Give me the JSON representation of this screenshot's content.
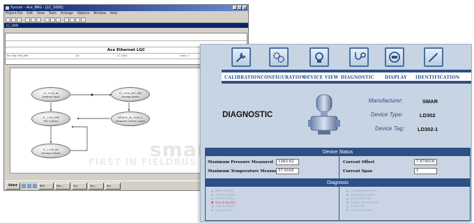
{
  "background_app": {
    "title": "Syscon - Ace_BRG - [LC_1000]",
    "window_buttons": [
      "_",
      "□",
      "×"
    ],
    "menu": [
      "Project File",
      "Edit",
      "View",
      "Tools",
      "Arrange",
      "Options",
      "Window",
      "Help"
    ],
    "inner_title": "LC_1000",
    "header_title": "Ace Ethernet LGC",
    "header_cells": [
      "Bus Tag: HSE_Net",
      "1/0",
      "LC-1000",
      "Lamp: 1"
    ],
    "nodes": [
      {
        "tag": "LT_1100_AI",
        "type": "Analog Input"
      },
      {
        "tag": "LT_1100_PID",
        "type": "PID Control"
      },
      {
        "tag": "LT_1100_AO",
        "type": "Analog Output"
      },
      {
        "tag": "LT_1100_MO_ADJ",
        "type": "Analog Alarm"
      },
      {
        "tag": "DEVICE_ID_1100_1",
        "type": "Setpoint Control Layer"
      }
    ],
    "status_text": "Zoom: 100%  Y: 0",
    "watermark": "smar",
    "watermark_sub": "FIRST IN FIELDBUS",
    "taskbar": {
      "start": "Start",
      "tasks": [
        "BRG",
        "Des...",
        "Ace",
        "Sys...",
        "Sys"
      ],
      "clock": "11:22"
    }
  },
  "device_page": {
    "nav": [
      {
        "label": "CALIBRATION",
        "icon": "wrench-icon"
      },
      {
        "label": "CONFIGURATION",
        "icon": "gears-icon"
      },
      {
        "label": "DEVICE VIEW",
        "icon": "transmitter-icon"
      },
      {
        "label": "DIAGNOSTIC",
        "icon": "stethoscope-icon"
      },
      {
        "label": "DISPLAY",
        "icon": "display-icon"
      },
      {
        "label": "IDENTIFICATION",
        "icon": "pen-icon"
      }
    ],
    "page_title": "DIAGNOSTIC",
    "info": {
      "manufacturer_label": "Manufacturer:",
      "manufacturer_value": "SMAR",
      "device_type_label": "Device Type:",
      "device_type_value": "LD302",
      "device_tag_label": "Device Tag:",
      "device_tag_value": "LD302-1"
    },
    "device_status": {
      "heading": "Device Status",
      "max_pressure_label": "Maximum Pressure Measured",
      "max_pressure_value": "1083.62",
      "max_temp_label": "Maximum Temperature Measured",
      "max_temp_value": "57.9165",
      "current_offset_label": "Current Offset",
      "current_offset_value": "7.874016",
      "current_span_label": "Current Span",
      "current_span_value": "1"
    },
    "diagnosis": {
      "heading": "Diagnosis",
      "left_items": [
        "Block Config",
        "Sensor Failure",
        "Memory Error",
        "Out of Service",
        "Output Failure",
        "Input Failure"
      ],
      "left_alert_index": 3,
      "right_items": [
        "Configuration Error",
        "Simulation Active",
        "Local Override",
        "Device Needs Maint",
        "Power Up",
        "Lost Static Data"
      ]
    }
  },
  "colors": {
    "accent_blue": "#2d4f86",
    "panel_bg": "#c7d4e3",
    "alert_red": "#d94a3a"
  }
}
